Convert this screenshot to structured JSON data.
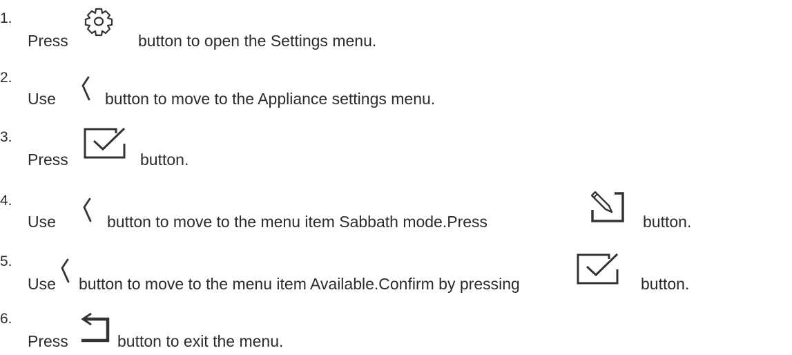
{
  "steps": [
    {
      "number": "1.",
      "pre": "Press",
      "icon": "gear-icon",
      "post": "button to open the Settings menu."
    },
    {
      "number": "2.",
      "pre": "Use",
      "icon": "chevron-left-icon",
      "post": "button to move to the Appliance settings menu."
    },
    {
      "number": "3.",
      "pre": "Press",
      "icon": "checkbox-check-icon",
      "post": "button."
    },
    {
      "number": "4.",
      "pre": "Use",
      "icon": "chevron-left-icon",
      "middle": "button to move to the menu item Sabbath mode.Press",
      "icon2": "edit-pencil-icon",
      "post": "button."
    },
    {
      "number": "5.",
      "pre": "Use",
      "icon": "chevron-left-icon",
      "middle": "button to move to the menu item Available.Confirm by pressing",
      "icon2": "checkbox-check-icon",
      "post": "button."
    },
    {
      "number": "6.",
      "pre": "Press",
      "icon": "back-arrow-icon",
      "post": "button to exit the menu."
    }
  ]
}
